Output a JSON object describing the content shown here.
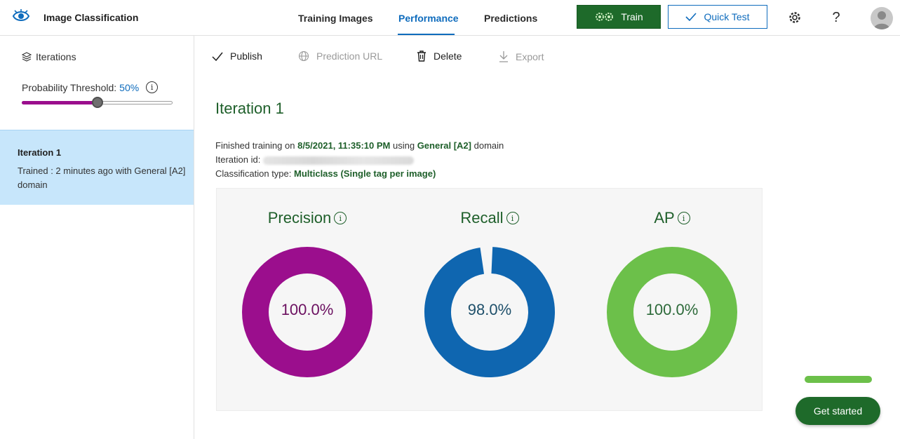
{
  "header": {
    "app_title": "Image Classification",
    "tabs": [
      {
        "label": "Training Images",
        "active": false
      },
      {
        "label": "Performance",
        "active": true
      },
      {
        "label": "Predictions",
        "active": false
      }
    ],
    "train_label": "Train",
    "quick_test_label": "Quick Test",
    "help_glyph": "?",
    "icons": [
      "eye-icon",
      "gears-icon",
      "check-icon",
      "settings-icon",
      "help-icon",
      "avatar"
    ]
  },
  "sidebar": {
    "iterations_label": "Iterations",
    "threshold_label": "Probability Threshold:",
    "threshold_value": "50%",
    "threshold_fraction": 0.5,
    "iteration": {
      "name": "Iteration 1",
      "description": "Trained : 2 minutes ago with General [A2] domain"
    }
  },
  "commands": [
    {
      "label": "Publish",
      "icon": "check-icon",
      "enabled": true
    },
    {
      "label": "Prediction URL",
      "icon": "globe-icon",
      "enabled": false
    },
    {
      "label": "Delete",
      "icon": "trash-icon",
      "enabled": true
    },
    {
      "label": "Export",
      "icon": "download-icon",
      "enabled": false
    }
  ],
  "main": {
    "title": "Iteration 1",
    "finished_prefix": "Finished training on",
    "finished_date": "8/5/2021, 11:35:10 PM",
    "using_text": "using",
    "domain": "General [A2]",
    "domain_suffix": "domain",
    "iteration_id_label": "Iteration id:",
    "classification_label": "Classification type:",
    "classification_value": "Multiclass (Single tag per image)"
  },
  "metrics": [
    {
      "label": "Precision",
      "value_text": "100.0%",
      "value": 100.0,
      "color": "#9b0e8d",
      "text_color": "#6b1060"
    },
    {
      "label": "Recall",
      "value_text": "98.0%",
      "value": 98.0,
      "color": "#0f66b0",
      "text_color": "#1e4f6a"
    },
    {
      "label": "AP",
      "value_text": "100.0%",
      "value": 100.0,
      "color": "#6cc04a",
      "text_color": "#2d6a3a"
    }
  ],
  "get_started_label": "Get started",
  "get_started_progress": 1.0
}
